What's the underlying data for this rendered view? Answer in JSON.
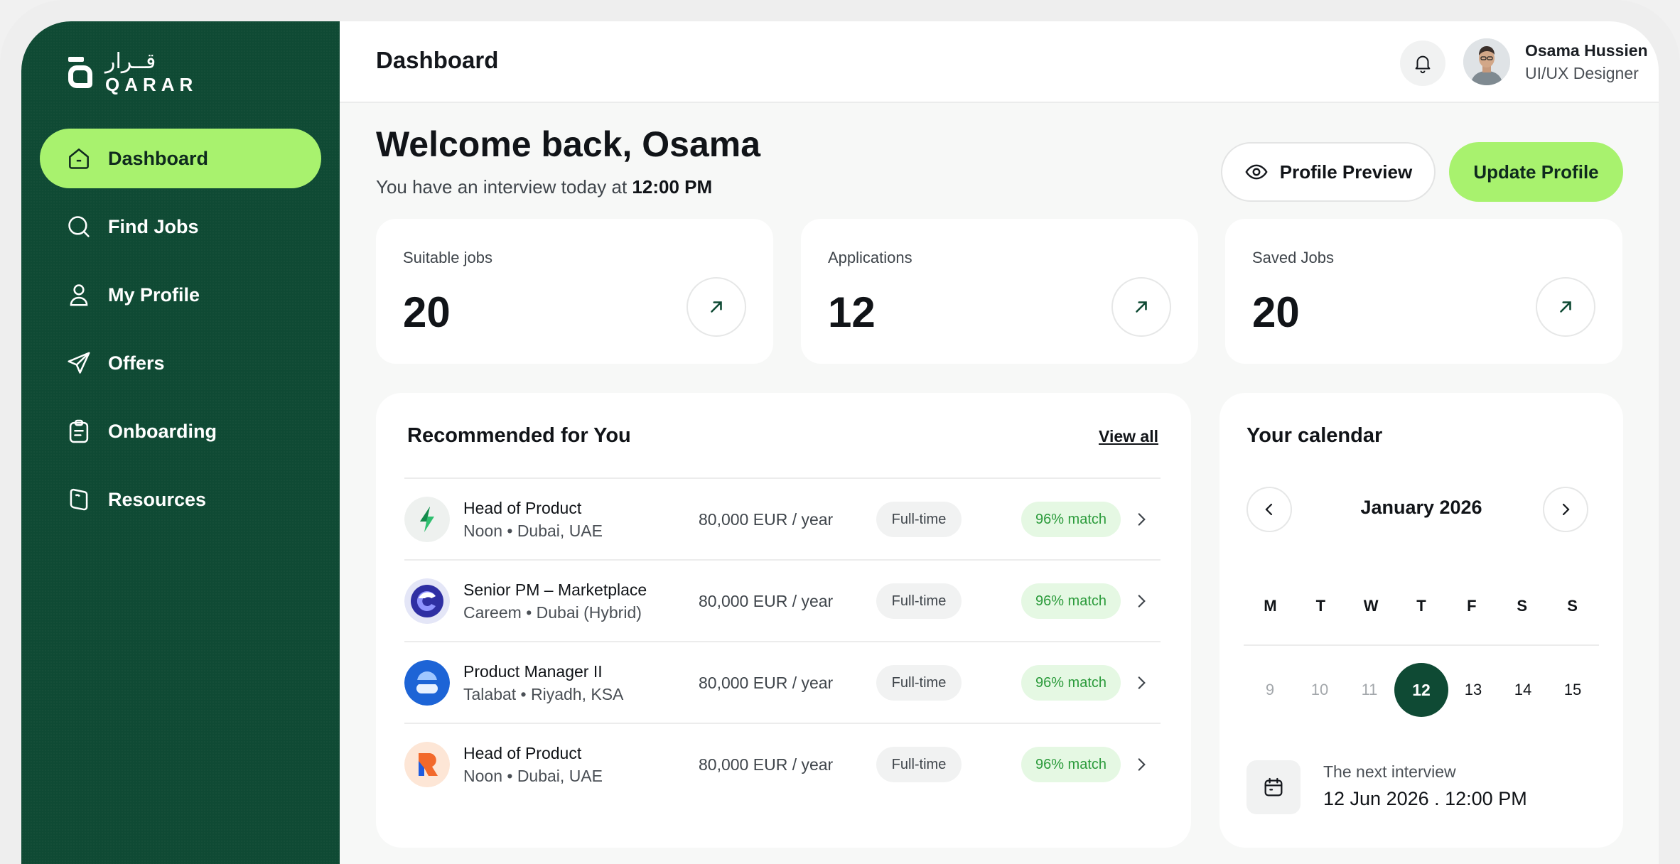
{
  "brand": {
    "arabic": "قــرار",
    "latin": "QARAR"
  },
  "sidebar": {
    "items": [
      {
        "label": "Dashboard",
        "icon": "home-icon",
        "active": true
      },
      {
        "label": "Find Jobs",
        "icon": "search-icon",
        "active": false
      },
      {
        "label": "My Profile",
        "icon": "user-icon",
        "active": false
      },
      {
        "label": "Offers",
        "icon": "send-icon",
        "active": false
      },
      {
        "label": "Onboarding",
        "icon": "clipboard-icon",
        "active": false
      },
      {
        "label": "Resources",
        "icon": "book-icon",
        "active": false
      }
    ]
  },
  "header": {
    "title": "Dashboard",
    "user": {
      "name": "Osama Hussien",
      "role": "UI/UX Designer"
    }
  },
  "welcome": {
    "title": "Welcome back, Osama",
    "subtitle_prefix": "You have an interview today at ",
    "subtitle_time": "12:00 PM"
  },
  "actions": {
    "preview": "Profile Preview",
    "update": "Update Profile"
  },
  "stats": [
    {
      "label": "Suitable jobs",
      "value": "20"
    },
    {
      "label": "Applications",
      "value": "12"
    },
    {
      "label": "Saved Jobs",
      "value": "20"
    }
  ],
  "recommended": {
    "title": "Recommended for You",
    "view_all": "View all",
    "jobs": [
      {
        "title": "Head of Product",
        "meta": "Noon • Dubai, UAE",
        "salary": "80,000 EUR / year",
        "type": "Full-time",
        "match": "96% match",
        "logo": "noon-green-logo"
      },
      {
        "title": "Senior PM – Marketplace",
        "meta": "Careem • Dubai (Hybrid)",
        "salary": "80,000 EUR / year",
        "type": "Full-time",
        "match": "96% match",
        "logo": "careem-logo"
      },
      {
        "title": "Product Manager II",
        "meta": "Talabat • Riyadh, KSA",
        "salary": "80,000 EUR / year",
        "type": "Full-time",
        "match": "96% match",
        "logo": "talabat-logo"
      },
      {
        "title": "Head of Product",
        "meta": "Noon • Dubai, UAE",
        "salary": "80,000 EUR / year",
        "type": "Full-time",
        "match": "96% match",
        "logo": "noon-orange-logo"
      }
    ]
  },
  "calendar": {
    "title": "Your calendar",
    "month": "January  2026",
    "weekdays": [
      "M",
      "T",
      "W",
      "T",
      "F",
      "S",
      "S"
    ],
    "dates": [
      "9",
      "10",
      "11",
      "12",
      "13",
      "14",
      "15"
    ],
    "today": "12",
    "next_label": "The next interview",
    "next_date": "12 Jun 2026 . 12:00 PM"
  },
  "colors": {
    "sidebar": "#0f4a34",
    "accent": "#a8f26e",
    "match_text": "#2b9b3b",
    "match_bg": "#e5f8e3"
  }
}
